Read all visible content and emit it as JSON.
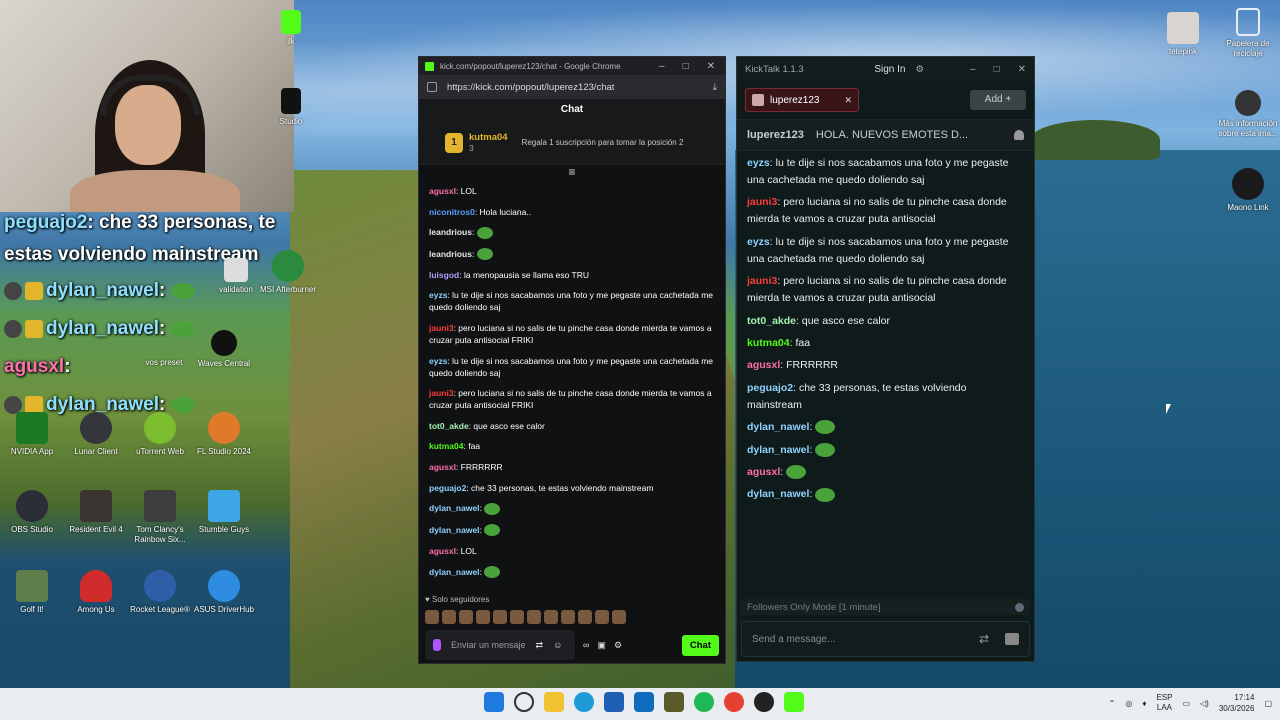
{
  "webcam_overlay": {
    "lines": [
      {
        "user": "peguajo2",
        "text": ": che 33 personas, te"
      },
      {
        "user": "",
        "text": "estas volviendo mainstream"
      },
      {
        "user": "dylan_nawel",
        "text": ":"
      },
      {
        "user": "dylan_nawel",
        "text": ":"
      },
      {
        "user": "agusxl",
        "text": ":"
      },
      {
        "user": "dylan_nawel",
        "text": ":"
      }
    ]
  },
  "desktop_icons": [
    {
      "label": "NVIDIA App"
    },
    {
      "label": "Lunar Client"
    },
    {
      "label": "uTorrent Web"
    },
    {
      "label": "FL Studio 2024"
    },
    {
      "label": "OBS Studio"
    },
    {
      "label": "Resident Evil 4"
    },
    {
      "label": "Tom Clancy's Rainbow Six..."
    },
    {
      "label": "Stumble Guys"
    },
    {
      "label": "Golf It!"
    },
    {
      "label": "Among Us"
    },
    {
      "label": "Rocket League®"
    },
    {
      "label": "ASUS DriverHub"
    },
    {
      "label": "MSI Afterburner"
    },
    {
      "label": "validation"
    },
    {
      "label": "Waves Central"
    },
    {
      "label": "vos preset"
    },
    {
      "label": "tetepink"
    },
    {
      "label": "Papelera de reciclaje"
    },
    {
      "label": "Más información sobre esta ima..."
    },
    {
      "label": "Maono Link"
    },
    {
      "label": "Studio"
    },
    {
      "label": "ilk"
    }
  ],
  "chrome": {
    "title": "kick.com/popout/luperez123/chat - Google Chrome",
    "url": "https://kick.com/popout/luperez123/chat",
    "chat_header": "Chat",
    "pinned": {
      "rank": "1",
      "user": "kutma04",
      "count": "3",
      "gift_text": "Regala 1 suscripción para tomar la posición 2"
    },
    "messages": [
      {
        "user": "agusxl",
        "color": "#ff6fa8",
        "text": "LOL"
      },
      {
        "user": "niconitros0",
        "color": "#5aa0ff",
        "text": "Hola luciana.."
      },
      {
        "user": "leandrious",
        "color": "#e6e6e6",
        "text": ""
      },
      {
        "user": "leandrious",
        "color": "#e6e6e6",
        "text": ""
      },
      {
        "user": "luisgod",
        "color": "#b49cff",
        "text": "la menopausia se llama eso TRU"
      },
      {
        "user": "eyzs",
        "color": "#8fd3ff",
        "text": "lu te dije si nos sacabamos una foto y me pegaste una cachetada me quedo doliendo saj"
      },
      {
        "user": "jauni3",
        "color": "#ff3b3b",
        "text": "pero luciana si no salis de tu pinche casa donde mierda te vamos a cruzar puta antisocial FRIKI"
      },
      {
        "user": "eyzs",
        "color": "#8fd3ff",
        "text": "lu te dije si nos sacabamos una foto y me pegaste una cachetada me quedo doliendo saj"
      },
      {
        "user": "jauni3",
        "color": "#ff3b3b",
        "text": "pero luciana si no salis de tu pinche casa donde mierda te vamos a cruzar puta antisocial FRIKI"
      },
      {
        "user": "tot0_akde",
        "color": "#a6f0b0",
        "text": "que asco ese calor"
      },
      {
        "user": "kutma04",
        "color": "#53fc18",
        "text": "faa"
      },
      {
        "user": "agusxl",
        "color": "#ff6fa8",
        "text": "FRRRRRR"
      },
      {
        "user": "peguajo2",
        "color": "#8fd3ff",
        "text": "che 33 personas, te estas volviendo mainstream"
      },
      {
        "user": "dylan_nawel",
        "color": "#8fd3ff",
        "text": ""
      },
      {
        "user": "dylan_nawel",
        "color": "#8fd3ff",
        "text": ""
      },
      {
        "user": "agusxl",
        "color": "#ff6fa8",
        "text": "LOL"
      },
      {
        "user": "dylan_nawel",
        "color": "#8fd3ff",
        "text": ""
      }
    ],
    "followers_only": "Solo seguidores",
    "input_placeholder": "Enviar un mensaje",
    "send_label": "Chat"
  },
  "kicktalk": {
    "title": "KickTalk 1.1.3",
    "sign_in": "Sign In",
    "tab_label": "luperez123",
    "add_label": "Add",
    "stream_user": "luperez123",
    "stream_title": "HOLA. NUEVOS EMOTES D...",
    "messages": [
      {
        "user": "eyzs",
        "color": "#8fd3ff",
        "text": "lu te dije si nos sacabamos una foto y me pegaste una cachetada me quedo doliendo saj"
      },
      {
        "user": "jauni3",
        "color": "#ff3b3b",
        "text": "pero luciana si no salis de tu pinche casa donde mierda te vamos a cruzar puta antisocial"
      },
      {
        "user": "eyzs",
        "color": "#8fd3ff",
        "text": "lu te dije si nos sacabamos una foto y me pegaste una cachetada me quedo doliendo saj"
      },
      {
        "user": "jauni3",
        "color": "#ff3b3b",
        "text": "pero luciana si no salis de tu pinche casa donde mierda te vamos a cruzar puta antisocial"
      },
      {
        "user": "tot0_akde",
        "color": "#a6f0b0",
        "text": "que asco ese calor"
      },
      {
        "user": "kutma04",
        "color": "#53fc18",
        "text": "faa"
      },
      {
        "user": "agusxl",
        "color": "#ff6fa8",
        "text": "FRRRRRR"
      },
      {
        "user": "peguajo2",
        "color": "#8fd3ff",
        "text": "che 33 personas, te estas volviendo mainstream"
      },
      {
        "user": "dylan_nawel",
        "color": "#8fd3ff",
        "text": ""
      },
      {
        "user": "dylan_nawel",
        "color": "#8fd3ff",
        "text": ""
      },
      {
        "user": "agusxl",
        "color": "#ff6fa8",
        "text": ""
      },
      {
        "user": "dylan_nawel",
        "color": "#8fd3ff",
        "text": ""
      }
    ],
    "followers_mode": "Followers Only Mode [1 minute]",
    "input_placeholder": "Send a message..."
  },
  "taskbar": {
    "lang1": "ESP",
    "lang2": "LAA",
    "time": "17:14",
    "date": "30/3/2026"
  }
}
